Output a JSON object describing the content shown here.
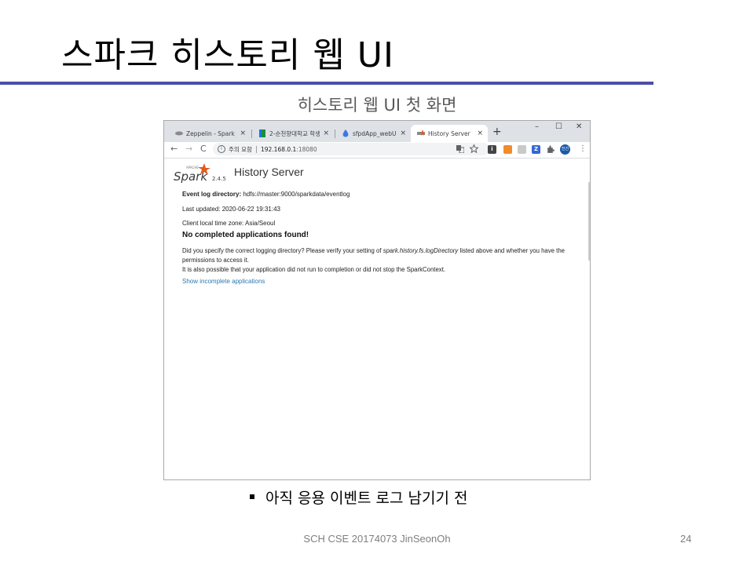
{
  "slide": {
    "title": "스파크 히스토리 웹 UI",
    "subtitle": "히스토리 웹 UI 첫 화면",
    "bullet": "아직 응용 이벤트 로그 남기기 전",
    "footer": "SCH CSE 20174073 JinSeonOh",
    "page_number": "24"
  },
  "browser": {
    "tabs": [
      {
        "label": "Zeppelin - Spark Jo",
        "close": "×",
        "icon": "zeppelin-favicon"
      },
      {
        "label": "2-순천향대학교 학생",
        "close": "×",
        "icon": "sheets-favicon"
      },
      {
        "label": "sfpdApp_webUI - Ze",
        "close": "×",
        "icon": "drop-favicon"
      },
      {
        "label": "History Server",
        "close": "×",
        "icon": "spark-favicon",
        "active": true
      }
    ],
    "new_tab": "+",
    "window_controls": {
      "minimize": "–",
      "maximize": "☐",
      "close": "✕"
    },
    "nav": {
      "back": "←",
      "forward": "→",
      "reload": "C"
    },
    "address": {
      "security_label": "주의 요함",
      "host": "192.168.0.1",
      "port": ":18080"
    },
    "toolbar_icons": [
      "translate-icon",
      "bookmark-star-icon",
      "extension-icons",
      "profile-avatar"
    ],
    "profile_label": "진선",
    "menu": "⋮"
  },
  "page": {
    "logo_text": "Spark",
    "logo_small": "APACHE",
    "version": "2.4.5",
    "heading": "History Server",
    "event_log_label": "Event log directory:",
    "event_log_value": " hdfs://master:9000/sparkdata/eventlog",
    "last_updated": "Last updated: 2020-06-22 19:31:43",
    "timezone": "Client local time zone: Asia/Seoul",
    "no_apps": "No completed applications found!",
    "para1_a": "Did you specify the correct logging directory? Please verify your setting of ",
    "para1_em": "spark.history.fs.logDirectory",
    "para1_b": " listed above and whether you have the permissions to access it.",
    "para2": "It is also possible that your application did not run to completion or did not stop the SparkContext.",
    "link": "Show incomplete applications"
  },
  "colors": {
    "title_rule": "#4b4ea8",
    "link": "#2a7ab0",
    "spark_orange": "#e25a1c"
  }
}
